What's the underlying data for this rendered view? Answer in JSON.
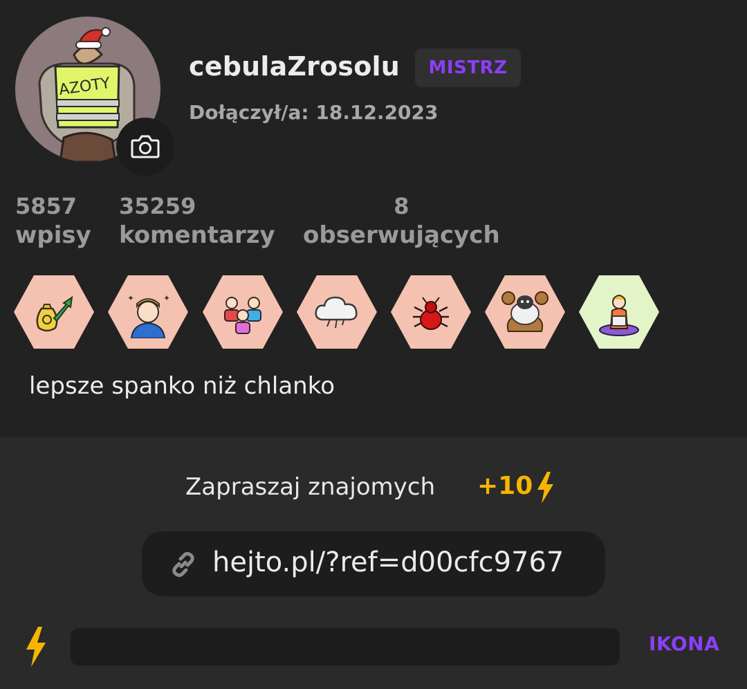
{
  "profile": {
    "username": "cebulaZrosolu",
    "rank": "MISTRZ",
    "joined": "Dołączył/a: 18.12.2023",
    "avatar_text": "AZOTY",
    "bio": "lepsze spanko niż chlanko"
  },
  "stats": [
    {
      "value": "5857",
      "label": "wpisy"
    },
    {
      "value": "35259",
      "label": "komentarzy"
    },
    {
      "value": "8",
      "label": "obserwujących"
    }
  ],
  "badges": [
    {
      "icon": "money-bag-growth-icon",
      "color": "#f5c2b1"
    },
    {
      "icon": "dizzy-person-icon",
      "color": "#f5c2b1"
    },
    {
      "icon": "group-people-icon",
      "color": "#f5c2b1"
    },
    {
      "icon": "cloud-storm-icon",
      "color": "#f5c2b1"
    },
    {
      "icon": "red-bug-icon",
      "color": "#f5c2b1"
    },
    {
      "icon": "sheep-icon",
      "color": "#f5c2b1"
    },
    {
      "icon": "meditating-person-laptop-icon",
      "color": "#e3f5c8"
    }
  ],
  "invite": {
    "text": "Zapraszaj znajomych",
    "bonus": "+10",
    "ref_link": "hejto.pl/?ref=d00cfc9767"
  },
  "footer": {
    "action_label": "IKONA",
    "progress": 0
  },
  "colors": {
    "accent": "#8b3ff5",
    "bolt": "#f7b500",
    "background": "#222222"
  }
}
